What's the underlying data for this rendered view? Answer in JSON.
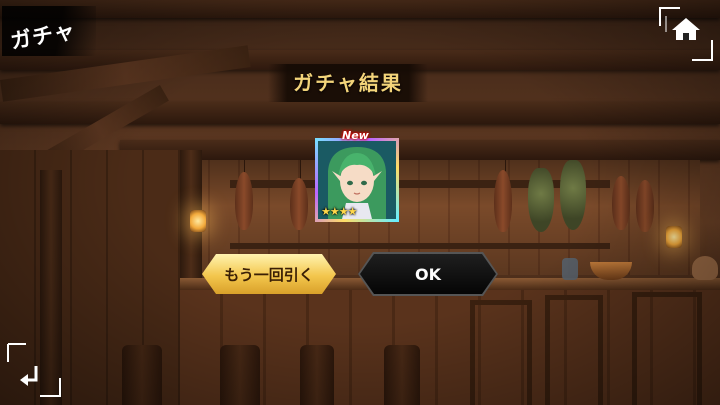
{
  "screen": {
    "title": "ガチャ",
    "result_title": "ガチャ結果"
  },
  "nav": {
    "home_icon": "home-icon",
    "back_icon": "return-arrow-icon"
  },
  "result_card": {
    "new_label": "New",
    "stars": "★★★★",
    "star_count": 4
  },
  "buttons": {
    "again_label": "もう一回引く",
    "ok_label": "OK"
  },
  "colors": {
    "title_gold": "#f3d47a",
    "again_button": "#f3c64d",
    "ok_button": "#0b0b0b",
    "star": "#ffd84a"
  }
}
